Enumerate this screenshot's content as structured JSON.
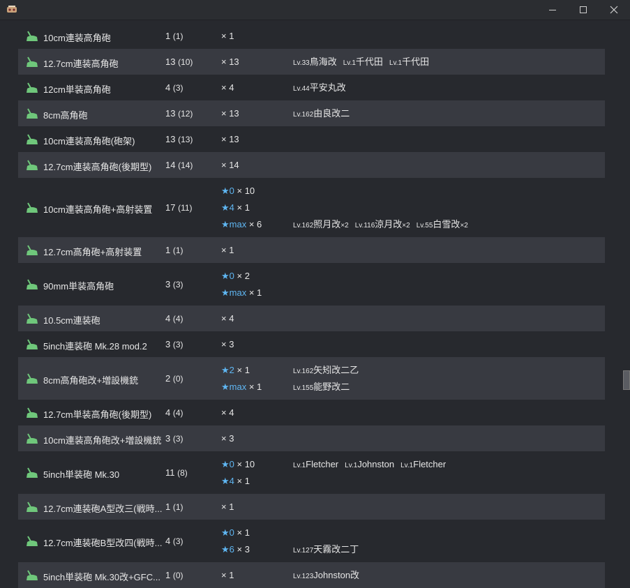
{
  "window": {
    "app_icon": "kancolle-app-icon",
    "controls": [
      "minimize-icon",
      "maximize-icon",
      "close-icon"
    ]
  },
  "colors": {
    "background": "#27292e",
    "row_alt": "#383a41",
    "star": "#5fb6f2",
    "icon_green": "#6fc77b"
  },
  "rows": [
    {
      "name": "10cm連装高角砲",
      "count": "1",
      "sub": "(1)",
      "levels": [
        {
          "star": "",
          "text": "× 1"
        }
      ],
      "ships": []
    },
    {
      "name": "12.7cm連装高角砲",
      "count": "13",
      "sub": "(10)",
      "levels": [
        {
          "star": "",
          "text": "× 13"
        }
      ],
      "ships": [
        [
          {
            "lv": "Lv.33",
            "name": "鳥海改",
            "mul": ""
          },
          {
            "lv": "Lv.1",
            "name": "千代田",
            "mul": ""
          },
          {
            "lv": "Lv.1",
            "name": "千代田",
            "mul": ""
          }
        ]
      ]
    },
    {
      "name": "12cm単装高角砲",
      "count": "4",
      "sub": "(3)",
      "levels": [
        {
          "star": "",
          "text": "× 4"
        }
      ],
      "ships": [
        [
          {
            "lv": "Lv.44",
            "name": "平安丸改",
            "mul": ""
          }
        ]
      ]
    },
    {
      "name": "8cm高角砲",
      "count": "13",
      "sub": "(12)",
      "levels": [
        {
          "star": "",
          "text": "× 13"
        }
      ],
      "ships": [
        [
          {
            "lv": "Lv.162",
            "name": "由良改二",
            "mul": ""
          }
        ]
      ]
    },
    {
      "name": "10cm連装高角砲(砲架)",
      "count": "13",
      "sub": "(13)",
      "levels": [
        {
          "star": "",
          "text": "× 13"
        }
      ],
      "ships": []
    },
    {
      "name": "12.7cm連装高角砲(後期型)",
      "count": "14",
      "sub": "(14)",
      "levels": [
        {
          "star": "",
          "text": "× 14"
        }
      ],
      "ships": []
    },
    {
      "name": "10cm連装高角砲+高射装置",
      "count": "17",
      "sub": "(11)",
      "levels": [
        {
          "star": "★0",
          "text": " × 10"
        },
        {
          "star": "★4",
          "text": " × 1"
        },
        {
          "star": "★max",
          "text": " × 6"
        }
      ],
      "ships": [
        [],
        [],
        [
          {
            "lv": "Lv.162",
            "name": "照月改",
            "mul": "×2"
          },
          {
            "lv": "Lv.116",
            "name": "涼月改",
            "mul": "×2"
          },
          {
            "lv": "Lv.55",
            "name": "白雪改",
            "mul": "×2"
          }
        ]
      ]
    },
    {
      "name": "12.7cm高角砲+高射装置",
      "count": "1",
      "sub": "(1)",
      "levels": [
        {
          "star": "",
          "text": "× 1"
        }
      ],
      "ships": []
    },
    {
      "name": "90mm単装高角砲",
      "count": "3",
      "sub": "(3)",
      "levels": [
        {
          "star": "★0",
          "text": " × 2"
        },
        {
          "star": "★max",
          "text": " × 1"
        }
      ],
      "ships": []
    },
    {
      "name": "10.5cm連装砲",
      "count": "4",
      "sub": "(4)",
      "levels": [
        {
          "star": "",
          "text": "× 4"
        }
      ],
      "ships": []
    },
    {
      "name": "5inch連装砲 Mk.28 mod.2",
      "count": "3",
      "sub": "(3)",
      "levels": [
        {
          "star": "",
          "text": "× 3"
        }
      ],
      "ships": []
    },
    {
      "name": "8cm高角砲改+増設機銃",
      "count": "2",
      "sub": "(0)",
      "levels": [
        {
          "star": "★2",
          "text": " × 1"
        },
        {
          "star": "★max",
          "text": " × 1"
        }
      ],
      "ships": [
        [
          {
            "lv": "Lv.162",
            "name": "矢矧改二乙",
            "mul": ""
          }
        ],
        [
          {
            "lv": "Lv.155",
            "name": "能野改二",
            "mul": ""
          }
        ]
      ]
    },
    {
      "name": "12.7cm単装高角砲(後期型)",
      "count": "4",
      "sub": "(4)",
      "levels": [
        {
          "star": "",
          "text": "× 4"
        }
      ],
      "ships": []
    },
    {
      "name": "10cm連装高角砲改+増設機銃",
      "count": "3",
      "sub": "(3)",
      "levels": [
        {
          "star": "",
          "text": "× 3"
        }
      ],
      "ships": []
    },
    {
      "name": "5inch単装砲 Mk.30",
      "count": "11",
      "sub": "(8)",
      "levels": [
        {
          "star": "★0",
          "text": " × 10"
        },
        {
          "star": "★4",
          "text": " × 1"
        }
      ],
      "ships": [
        [
          {
            "lv": "Lv.1",
            "name": "Fletcher",
            "mul": ""
          },
          {
            "lv": "Lv.1",
            "name": "Johnston",
            "mul": ""
          },
          {
            "lv": "Lv.1",
            "name": "Fletcher",
            "mul": ""
          }
        ]
      ]
    },
    {
      "name": "12.7cm連装砲A型改三(戦時...",
      "count": "1",
      "sub": "(1)",
      "levels": [
        {
          "star": "",
          "text": "× 1"
        }
      ],
      "ships": []
    },
    {
      "name": "12.7cm連装砲B型改四(戦時...",
      "count": "4",
      "sub": "(3)",
      "levels": [
        {
          "star": "★0",
          "text": " × 1"
        },
        {
          "star": "★6",
          "text": " × 3"
        }
      ],
      "ships": [
        [],
        [
          {
            "lv": "Lv.127",
            "name": "天霧改二丁",
            "mul": ""
          }
        ]
      ]
    },
    {
      "name": "5inch単装砲 Mk.30改+GFC...",
      "count": "1",
      "sub": "(0)",
      "levels": [
        {
          "star": "",
          "text": "× 1"
        }
      ],
      "ships": [
        [
          {
            "lv": "Lv.123",
            "name": "Johnston改",
            "mul": ""
          }
        ]
      ]
    }
  ]
}
